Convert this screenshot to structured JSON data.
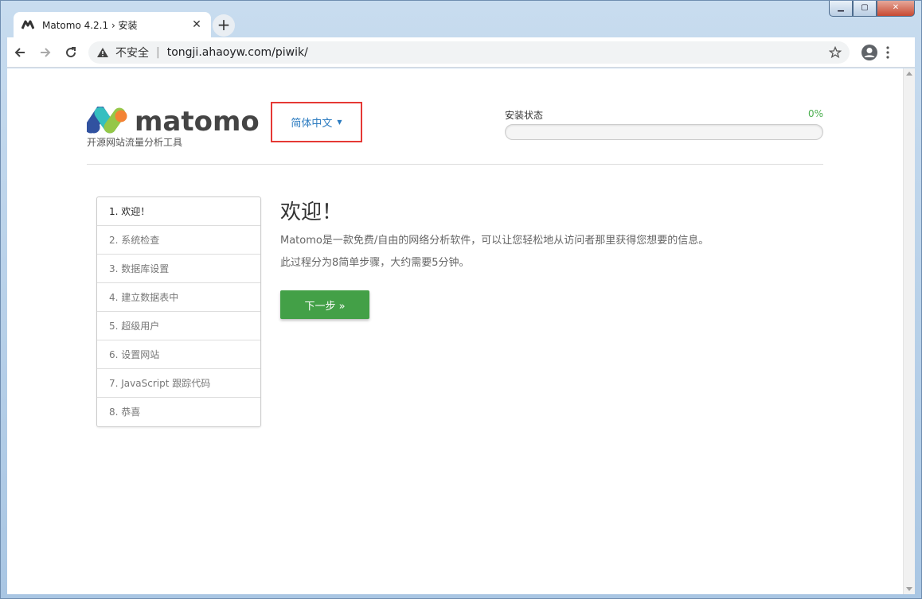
{
  "browser": {
    "tab_title": "Matomo 4.2.1 › 安装",
    "tab_close": "✕",
    "new_tab": "+",
    "security_label": "不安全",
    "separator": "|",
    "url": "tongji.ahaoyw.com/piwik/",
    "window_controls": {
      "minimize": "▁",
      "maximize": "▢",
      "close": "✕"
    }
  },
  "header": {
    "logo_alt": "matomo",
    "tagline": "开源网站流量分析工具",
    "language": "简体中文",
    "install_status_label": "安装状态",
    "install_progress_text": "0%",
    "install_progress": 0
  },
  "steps": [
    {
      "label": "1. 欢迎！",
      "active": true
    },
    {
      "label": "2. 系统检查",
      "active": false
    },
    {
      "label": "3. 数据库设置",
      "active": false
    },
    {
      "label": "4. 建立数据表中",
      "active": false
    },
    {
      "label": "5. 超级用户",
      "active": false
    },
    {
      "label": "6. 设置网站",
      "active": false
    },
    {
      "label": "7. JavaScript 跟踪代码",
      "active": false
    },
    {
      "label": "8. 恭喜",
      "active": false
    }
  ],
  "main": {
    "title": "欢迎！",
    "intro_line1": "Matomo是一款免费/自由的网络分析软件，可以让您轻松地从访问者那里获得您想要的信息。",
    "intro_line2": "此过程分为8简单步骤，大约需要5分钟。",
    "next_button": "下一步 »"
  },
  "colors": {
    "accent_green": "#43a047",
    "link_blue": "#2b7bc0",
    "highlight_red": "#e53935"
  },
  "icons": {
    "back": "arrow-left-icon",
    "forward": "arrow-right-icon",
    "reload": "reload-icon",
    "warning": "warning-icon",
    "bookmark": "star-icon",
    "profile": "account-icon",
    "menu": "kebab-menu-icon"
  }
}
